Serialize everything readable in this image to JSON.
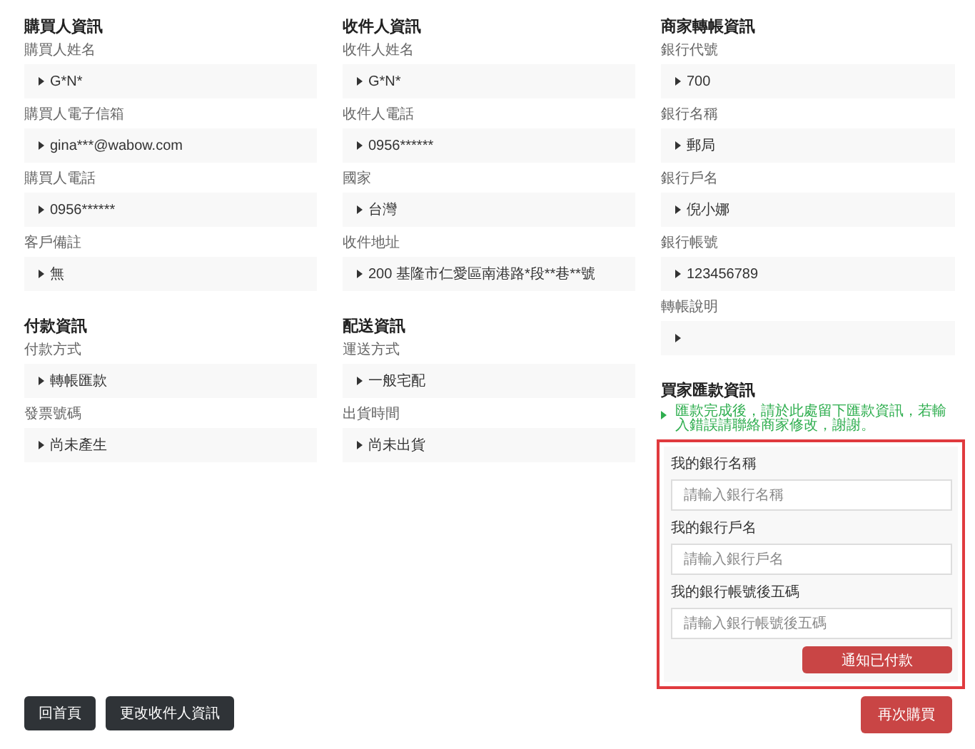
{
  "columns": [
    {
      "sections": [
        {
          "title": "購買人資訊",
          "fields": [
            {
              "label": "購買人姓名",
              "value": "G*N*"
            },
            {
              "label": "購買人電子信箱",
              "value": "gina***@wabow.com"
            },
            {
              "label": "購買人電話",
              "value": "0956******"
            },
            {
              "label": "客戶備註",
              "value": "無"
            }
          ]
        },
        {
          "title": "付款資訊",
          "fields": [
            {
              "label": "付款方式",
              "value": "轉帳匯款"
            },
            {
              "label": "發票號碼",
              "value": "尚未產生"
            }
          ]
        }
      ]
    },
    {
      "sections": [
        {
          "title": "收件人資訊",
          "fields": [
            {
              "label": "收件人姓名",
              "value": "G*N*"
            },
            {
              "label": "收件人電話",
              "value": "0956******"
            },
            {
              "label": "國家",
              "value": "台灣"
            },
            {
              "label": "收件地址",
              "value": "200 基隆市仁愛區南港路*段**巷**號"
            }
          ]
        },
        {
          "title": "配送資訊",
          "fields": [
            {
              "label": "運送方式",
              "value": "一般宅配"
            },
            {
              "label": "出貨時間",
              "value": "尚未出貨"
            }
          ]
        }
      ]
    },
    {
      "sections": [
        {
          "title": "商家轉帳資訊",
          "fields": [
            {
              "label": "銀行代號",
              "value": "700"
            },
            {
              "label": "銀行名稱",
              "value": "郵局"
            },
            {
              "label": "銀行戶名",
              "value": "倪小娜"
            },
            {
              "label": "銀行帳號",
              "value": "123456789"
            },
            {
              "label": "轉帳說明"
            }
          ]
        }
      ],
      "remit": {
        "title": "買家匯款資訊",
        "note": "匯款完成後，請於此處留下匯款資訊，若輸入錯誤請聯絡商家修改，謝謝。",
        "inputs": [
          {
            "label": "我的銀行名稱",
            "placeholder": "請輸入銀行名稱"
          },
          {
            "label": "我的銀行戶名",
            "placeholder": "請輸入銀行戶名"
          },
          {
            "label": "我的銀行帳號後五碼",
            "placeholder": "請輸入銀行帳號後五碼"
          }
        ],
        "submit": "通知已付款"
      }
    }
  ],
  "left_buttons": [
    "回首頁",
    "更改收件人資訊"
  ],
  "right_button": "再次購買"
}
